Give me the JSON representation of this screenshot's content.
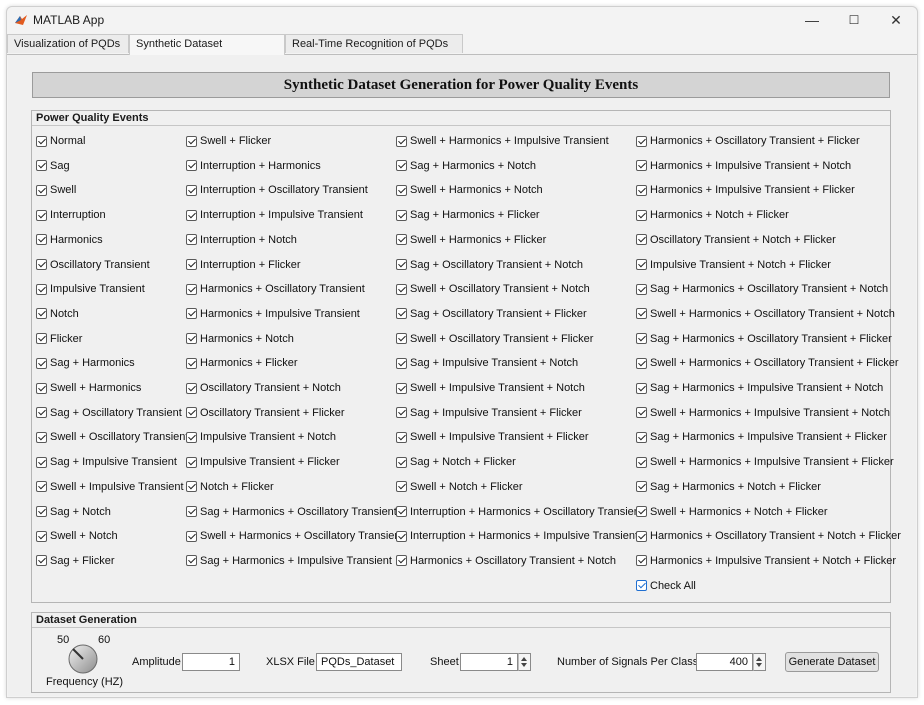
{
  "window": {
    "title": "MATLAB App",
    "controls": [
      "—",
      "☐",
      "✕"
    ]
  },
  "tabs": [
    "Visualization of PQDs",
    "Synthetic Dataset Generation",
    "Real-Time Recognition of PQDs"
  ],
  "active_tab": 1,
  "banner": "Synthetic Dataset Generation for Power Quality Events",
  "events_panel": {
    "title": "Power Quality Events",
    "columns": [
      [
        "Normal",
        "Sag",
        "Swell",
        "Interruption",
        "Harmonics",
        "Oscillatory Transient",
        "Impulsive Transient",
        "Notch",
        "Flicker",
        "Sag + Harmonics",
        "Swell + Harmonics",
        "Sag + Oscillatory Transient",
        "Swell + Oscillatory Transient",
        "Sag + Impulsive Transient",
        "Swell + Impulsive Transient",
        "Sag + Notch",
        "Swell + Notch",
        "Sag + Flicker"
      ],
      [
        "Swell + Flicker",
        "Interruption + Harmonics",
        "Interruption + Oscillatory Transient",
        "Interruption + Impulsive Transient",
        "Interruption + Notch",
        "Interruption + Flicker",
        "Harmonics + Oscillatory Transient",
        "Harmonics + Impulsive Transient",
        "Harmonics + Notch",
        "Harmonics + Flicker",
        "Oscillatory Transient + Notch",
        "Oscillatory Transient + Flicker",
        "Impulsive Transient + Notch",
        "Impulsive Transient + Flicker",
        "Notch + Flicker",
        "Sag + Harmonics + Oscillatory Transient",
        "Swell + Harmonics + Oscillatory Transient",
        "Sag + Harmonics + Impulsive Transient"
      ],
      [
        "Swell + Harmonics + Impulsive Transient",
        "Sag + Harmonics + Notch",
        "Swell + Harmonics + Notch",
        "Sag + Harmonics + Flicker",
        "Swell + Harmonics + Flicker",
        "Sag + Oscillatory Transient + Notch",
        "Swell + Oscillatory Transient + Notch",
        "Sag + Oscillatory Transient + Flicker",
        "Swell + Oscillatory Transient + Flicker",
        "Sag + Impulsive Transient + Notch",
        "Swell + Impulsive Transient + Notch",
        "Sag + Impulsive Transient + Flicker",
        "Swell + Impulsive Transient + Flicker",
        "Sag + Notch + Flicker",
        "Swell + Notch + Flicker",
        "Interruption + Harmonics + Oscillatory Transient",
        "Interruption + Harmonics + Impulsive Transient",
        "Harmonics + Oscillatory Transient + Notch"
      ],
      [
        "Harmonics + Oscillatory Transient + Flicker",
        "Harmonics + Impulsive Transient + Notch",
        "Harmonics + Impulsive Transient + Flicker",
        "Harmonics + Notch + Flicker",
        "Oscillatory Transient + Notch + Flicker",
        "Impulsive Transient + Notch + Flicker",
        "Sag + Harmonics + Oscillatory Transient + Notch",
        "Swell + Harmonics + Oscillatory Transient + Notch",
        "Sag + Harmonics + Oscillatory Transient + Flicker",
        "Swell + Harmonics + Oscillatory Transient + Flicker",
        "Sag + Harmonics + Impulsive Transient + Notch",
        "Swell + Harmonics + Impulsive Transient + Notch",
        "Sag + Harmonics + Impulsive Transient + Flicker",
        "Swell + Harmonics + Impulsive Transient + Flicker",
        "Sag + Harmonics + Notch + Flicker",
        "Swell + Harmonics + Notch + Flicker",
        "Harmonics + Oscillatory Transient + Notch + Flicker",
        "Harmonics + Impulsive Transient + Notch + Flicker",
        "Check All"
      ]
    ],
    "all_checked": true
  },
  "dataset_panel": {
    "title": "Dataset Generation",
    "knob": {
      "min_label": "50",
      "max_label": "60",
      "label": "Frequency (HZ)"
    },
    "amplitude": {
      "label": "Amplitude",
      "value": "1"
    },
    "xlsx": {
      "label": "XLSX File",
      "value": "PQDs_Dataset"
    },
    "sheet": {
      "label": "Sheet",
      "value": "1"
    },
    "signals": {
      "label": "Number of Signals Per Class",
      "value": "400"
    },
    "generate_button": "Generate Dataset"
  },
  "colors": {
    "check_all_accent": "#1f6fd1",
    "banner_bg": "#d4d4d4"
  }
}
